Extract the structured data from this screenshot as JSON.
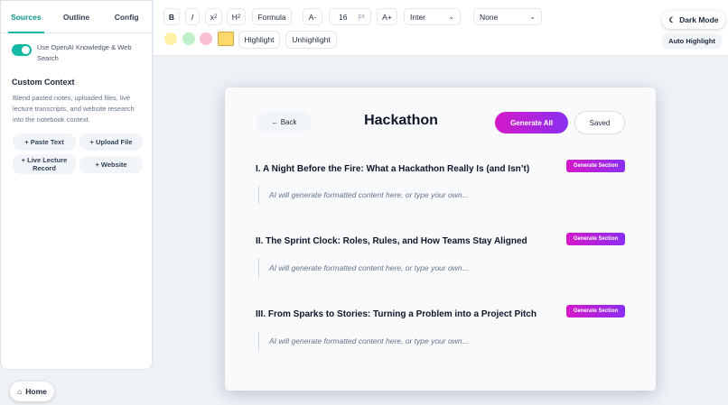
{
  "sidebar": {
    "tabs": [
      {
        "label": "Sources",
        "active": true
      },
      {
        "label": "Outline",
        "active": false
      },
      {
        "label": "Config",
        "active": false
      }
    ],
    "toggle_label": "Use OpenAI Knowledge & Web Search",
    "toggle_on": true,
    "custom_context_title": "Custom Context",
    "custom_context_desc": "Blend pasted notes, uploaded files, live lecture transcripts, and website research into the notebook context.",
    "source_buttons": [
      "+ Paste Text",
      "+ Upload File",
      "+ Live Lecture Record",
      "+ Website"
    ],
    "home_icon": "⌂",
    "home_label": "Home"
  },
  "toolbar": {
    "bold": "B",
    "italic": "I",
    "superscript_base": "x",
    "superscript_exp": "2",
    "subscript_base": "H",
    "subscript_exp": "2",
    "formula": "Formula",
    "font_decrease": "A-",
    "font_size": "16",
    "font_unit": "px",
    "font_increase": "A+",
    "font_family": "Inter",
    "style_select": "None",
    "highlight_colors": [
      "#fdf1a6",
      "#bdf0c6",
      "#f9bfd5"
    ],
    "selected_color": "#fcd96a",
    "highlight_label": "Highlight",
    "unhighlight_label": "Unhighlight",
    "dark_mode_icon": "☾",
    "dark_mode_label": "Dark Mode",
    "auto_highlight_label": "Auto Highlight"
  },
  "document": {
    "back_label": "← Back",
    "title": "Hackathon",
    "generate_all_label": "Generate All",
    "saved_label": "Saved",
    "generate_section_label": "Generate Section",
    "sections": [
      {
        "title": "I. A Night Before the Fire: What a Hackathon Really Is (and Isn’t)",
        "placeholder": "AI will generate formatted content here, or type your own..."
      },
      {
        "title": "II. The Sprint Clock: Roles, Rules, and How Teams Stay Aligned",
        "placeholder": "AI will generate formatted content here, or type your own..."
      },
      {
        "title": "III. From Sparks to Stories: Turning a Problem into a Project Pitch",
        "placeholder": "AI will generate formatted content here, or type your own..."
      }
    ]
  },
  "colors": {
    "accent_teal": "#14b8a6",
    "gradient_start": "#d418c8",
    "gradient_end": "#8b2ff0"
  }
}
